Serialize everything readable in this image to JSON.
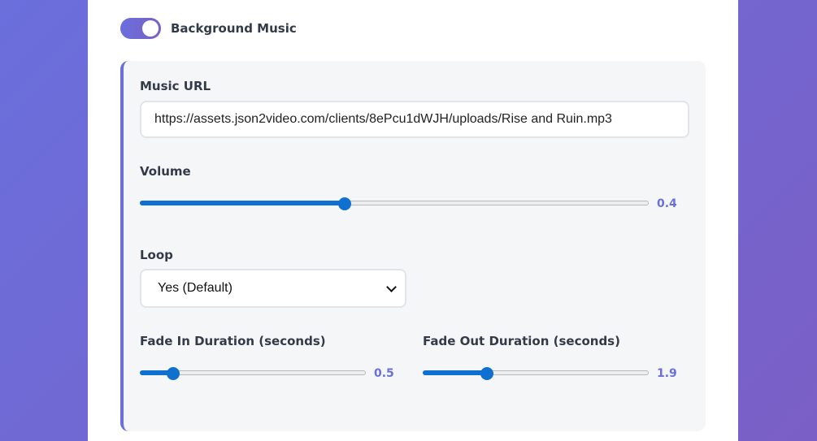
{
  "background_music": {
    "label": "Background Music",
    "enabled": true
  },
  "music_url": {
    "label": "Music URL",
    "value": "https://assets.json2video.com/clients/8ePcu1dWJH/uploads/Rise and Ruin.mp3"
  },
  "volume": {
    "label": "Volume",
    "value": "0.4",
    "min": 0,
    "max": 1
  },
  "loop": {
    "label": "Loop",
    "selected": "Yes (Default)"
  },
  "fade_in": {
    "label": "Fade In Duration (seconds)",
    "value": "0.5",
    "min": 0,
    "max": 4
  },
  "fade_out": {
    "label": "Fade Out Duration (seconds)",
    "value": "1.9",
    "min": 0,
    "max": 7
  },
  "colors": {
    "accent": "#6a6fdc",
    "slider": "#0f70d0"
  }
}
